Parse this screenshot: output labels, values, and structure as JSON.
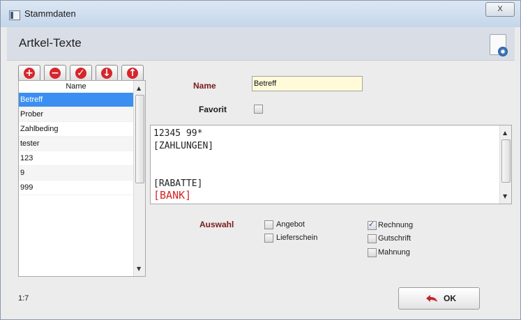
{
  "window": {
    "title": "Stammdaten",
    "close_label": "X"
  },
  "header": {
    "title": "Artkel-Texte"
  },
  "list": {
    "header": "Name",
    "items": [
      "Betreff",
      "Prober",
      "Zahlbeding",
      "tester",
      "123",
      "9",
      "999"
    ],
    "selected_index": 0
  },
  "form": {
    "name_label": "Name",
    "name_value": "Betreff",
    "favorit_label": "Favorit",
    "favorit_checked": false,
    "text_lines": [
      "12345  99*",
      "[ZAHLUNGEN]",
      "",
      "",
      "[RABATTE]",
      "[BANK]"
    ],
    "auswahl_label": "Auswahl",
    "options": {
      "angebot": {
        "label": "Angebot",
        "checked": false
      },
      "lieferschein": {
        "label": "Lieferschein",
        "checked": false
      },
      "rechnung": {
        "label": "Rechnung",
        "checked": true
      },
      "gutschrift": {
        "label": "Gutschrift",
        "checked": false
      },
      "mahnung": {
        "label": "Mahnung",
        "checked": false
      }
    }
  },
  "toolbar": {
    "buttons": [
      {
        "name": "add",
        "glyph": "+"
      },
      {
        "name": "remove",
        "glyph": "−"
      },
      {
        "name": "check",
        "glyph": "✓"
      },
      {
        "name": "move-down",
        "glyph": "↓"
      },
      {
        "name": "move-up",
        "glyph": "↑"
      }
    ]
  },
  "status": {
    "text": "1:7"
  },
  "ok_button": {
    "label": "OK"
  }
}
